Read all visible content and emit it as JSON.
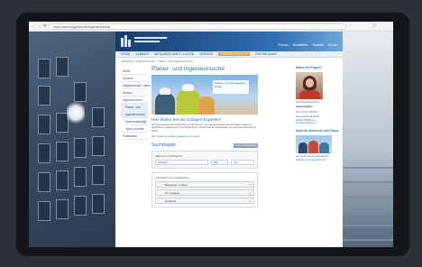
{
  "browser": {
    "nav_glyphs": "← → ⟳",
    "url": "https://www.ingpedia.de/ingenieursuche",
    "right_glyphs": "☆ ⋮"
  },
  "site": {
    "top_links": [
      "Presse",
      "Newsletter",
      "Kontakt",
      "Suche"
    ],
    "main_nav": [
      {
        "label": "HOME",
        "active": false
      },
      {
        "label": "KAMMER",
        "active": false
      },
      {
        "label": "MITGLIEDSCHAFT / LISTEN",
        "active": false
      },
      {
        "label": "SERVICE",
        "active": false
      },
      {
        "label": "INGENIEURSUCHE",
        "active": true
      },
      {
        "label": "FORTBILDUNG",
        "active": false
      }
    ],
    "breadcrumb": "Startseite › Ingenieursuche › Planer- und Ingenieursuche",
    "side_nav": [
      {
        "label": "Home",
        "type": "item"
      },
      {
        "label": "Kammer",
        "type": "item"
      },
      {
        "label": "Mitgliedschaft / Listen",
        "type": "item"
      },
      {
        "label": "Service",
        "type": "item"
      },
      {
        "label": "Ingenieursuche",
        "type": "item"
      },
      {
        "label": "Planer- und",
        "type": "current"
      },
      {
        "label": "Ingenieursuche",
        "type": "current"
      },
      {
        "label": "Sachverständige",
        "type": "sub"
      },
      {
        "label": "Open Journals",
        "type": "sub"
      },
      {
        "label": "Fortbildung",
        "type": "item"
      }
    ],
    "content": {
      "title": "Planer- und Ingenieursuche",
      "hero_overlay": "Suchen und Auftraggeber finden",
      "subtitle": "Hier finden Sie die richtigen Experten!",
      "intro": "Die Ingenieurkammer bietet Ihnen mit der Planer- und Ingenieursuche einen schnellen Zugang zu qualifizierten Ingenieurinnen und Ingenieuren. Nutzen Sie die Suchmaske, um passende Experten zu finden.",
      "hint_link": "Hier finden Sie weitere Hinweise zur Suche",
      "search_title": "Suchmaske",
      "reset_label": "Suche zurücksetzen",
      "search_box_label": "Allgemeine Suchbegriffe",
      "search_field_placeholder": "Suchwort",
      "plz_placeholder": "PLZ",
      "ort_placeholder": "Ort",
      "filters_label": "Auswählen einer Fachrichtung",
      "filter_items": [
        "Bauwesen / Listen",
        "Ihr Leistung",
        "Gebäude"
      ]
    },
    "sidebar": {
      "contact_heading": "Haben Sie Fragen?",
      "contact_name": "Frau Kortmann",
      "contact_role": "Ihre Ansprechpartnerin",
      "contact_lines": [
        "Tel. 0 23 06 / 99 25-0",
        "Fax 0 23 06 / 99 25-99",
        "E-Mail: info@ik.de"
      ],
      "contact_link": "Kontakt aufnehmen",
      "team_heading": "Ideen für Bauherren und Planer",
      "team_caption": "Hier finden Sie die wesentlichen Hinweise zur Ingenieursuche"
    }
  }
}
